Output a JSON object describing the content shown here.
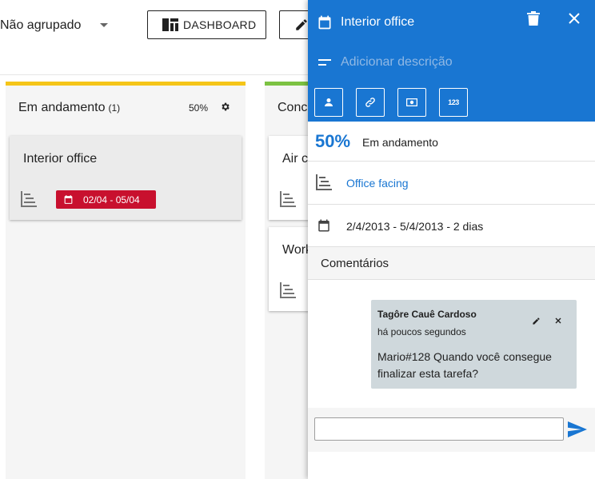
{
  "toolbar": {
    "grouping_value": "Não agrupado",
    "dashboard_label": "DASHBOARD"
  },
  "columns": [
    {
      "title": "Em andamento",
      "count": "(1)",
      "percent": "50%",
      "color": "#f5c518",
      "cards": [
        {
          "title": "Interior office",
          "date_range": "02/04 - 05/04",
          "date_color": "#c8102e"
        }
      ]
    },
    {
      "title": "Concl",
      "color": "#7cc242",
      "cards": [
        {
          "title": "Air c"
        },
        {
          "title": "Work"
        }
      ]
    }
  ],
  "panel": {
    "task_title": "Interior office",
    "description_placeholder": "Adicionar descrição",
    "header_color": "#1976d2",
    "action_buttons": [
      "person-icon",
      "link-icon",
      "money-icon",
      "numbers-icon"
    ],
    "action_numbers_glyph": "123",
    "progress_percent": "50",
    "progress_symbol": "%",
    "status": "Em andamento",
    "gantt_link": "Office facing",
    "date_range": "2/4/2013 - 5/4/2013 - 2 dias",
    "comments_heading": "Comentários",
    "comment": {
      "author": "Tagôre Cauê Cardoso",
      "time": "há poucos segundos",
      "text": "Mario#128 Quando você consegue finalizar esta tarefa?"
    },
    "new_comment_value": ""
  }
}
